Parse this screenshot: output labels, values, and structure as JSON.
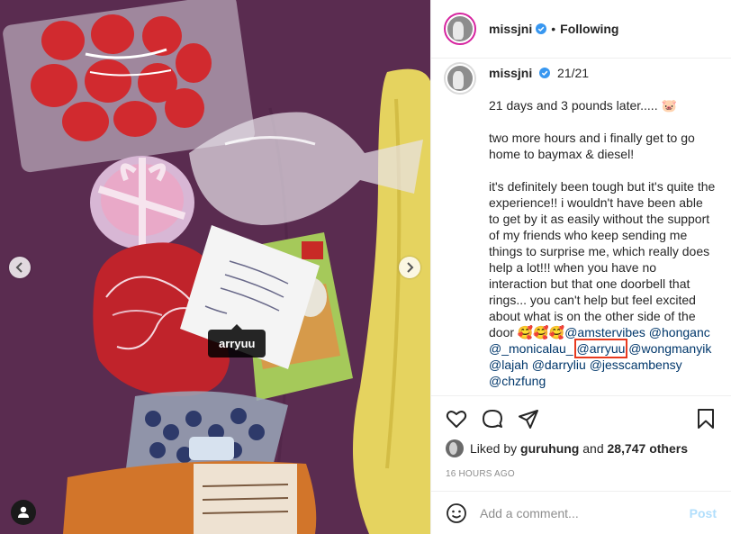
{
  "photo": {
    "tag_label": "arryuu",
    "prev_icon": "chevron-left-icon",
    "next_icon": "chevron-right-icon",
    "user_tags_icon": "person-icon",
    "colors": {
      "background": "#5b2e52",
      "tin": "#c4232a",
      "pillow": "#e7d35a"
    }
  },
  "header": {
    "username": "missjni",
    "separator": "•",
    "follow_state": "Following",
    "verified_icon": "verified-badge-icon"
  },
  "caption": {
    "username": "missjni",
    "title": "21/21",
    "line1": "21 days and 3 pounds later..... 🐷",
    "line2": "two more hours and i finally get to go home to baymax & diesel!",
    "line3": "it's definitely been tough but it's quite the experience!! i wouldn't have been able to get by it as easily without the support of my friends who keep sending me things to surprise me, which really does help a lot!!! when you have no interaction but that one doorbell that rings... you can't help but feel excited about what is on the other side of the door 🥰🥰🥰",
    "mentions": [
      "@amstervibes",
      "@honganc",
      "@_monicalau_",
      "@arryuu",
      "@wongmanyik",
      "@lajah",
      "@darryliu",
      "@jesscambensy",
      "@chzfung"
    ]
  },
  "actions": {
    "like_icon": "heart-icon",
    "comment_icon": "comment-bubble-icon",
    "share_icon": "paper-plane-icon",
    "save_icon": "bookmark-icon"
  },
  "likes": {
    "prefix": "Liked by",
    "user": "guruhung",
    "conjunction": "and",
    "others": "28,747 others"
  },
  "timestamp": "16 HOURS AGO",
  "comment": {
    "placeholder": "Add a comment...",
    "post_label": "Post",
    "emoji_icon": "smiley-icon"
  },
  "colors": {
    "mention": "#00376b",
    "highlight": "#e8391e",
    "verified": "#3897f0",
    "post_disabled": "#b2dffc"
  }
}
